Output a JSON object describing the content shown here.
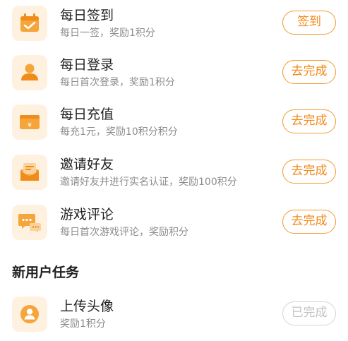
{
  "colors": {
    "accent": "#f29a2e",
    "accent_text": "#f28a1a",
    "icon_bg": "#fff1e0",
    "icon_fg": "#f5a53a",
    "title_text": "#1f1f1f",
    "desc_text": "#8c8c8c",
    "done_border": "#d4d4d4",
    "done_text": "#c2c2c2"
  },
  "daily_tasks": [
    {
      "icon": "calendar-check-icon",
      "title": "每日签到",
      "desc": "每日一签，奖励1积分",
      "button": "签到"
    },
    {
      "icon": "user-icon",
      "title": "每日登录",
      "desc": "每日首次登录，奖励1积分",
      "button": "去完成"
    },
    {
      "icon": "wallet-recharge-icon",
      "title": "每日充值",
      "desc": "每充1元，奖励10积分积分",
      "button": "去完成"
    },
    {
      "icon": "invite-envelope-icon",
      "title": "邀请好友",
      "desc": "邀请好友并进行实名认证，奖励100积分",
      "button": "去完成"
    },
    {
      "icon": "comment-bubbles-icon",
      "title": "游戏评论",
      "desc": "每日首次游戏评论，奖励积分",
      "button": "去完成"
    }
  ],
  "new_user_section": {
    "title": "新用户任务",
    "tasks": [
      {
        "icon": "avatar-upload-icon",
        "title": "上传头像",
        "desc": "奖励1积分",
        "button": "已完成"
      }
    ]
  }
}
